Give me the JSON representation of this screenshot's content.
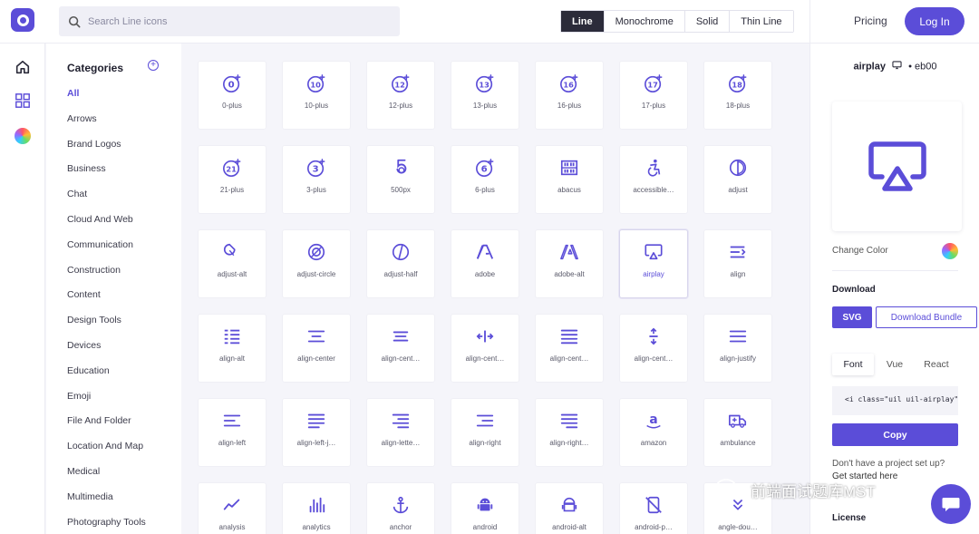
{
  "search": {
    "placeholder": "Search Line icons"
  },
  "styles": [
    "Line",
    "Monochrome",
    "Solid",
    "Thin Line"
  ],
  "active_style": "Line",
  "header": {
    "pricing": "Pricing",
    "login": "Log In"
  },
  "categories": {
    "title": "Categories",
    "items": [
      "All",
      "Arrows",
      "Brand Logos",
      "Business",
      "Chat",
      "Cloud And Web",
      "Communication",
      "Construction",
      "Content",
      "Design Tools",
      "Devices",
      "Education",
      "Emoji",
      "File And Folder",
      "Location And Map",
      "Medical",
      "Multimedia",
      "Photography Tools"
    ],
    "active": "All"
  },
  "icons": [
    {
      "label": "0-plus",
      "icon": "0-plus-icon"
    },
    {
      "label": "10-plus",
      "icon": "10-plus-icon"
    },
    {
      "label": "12-plus",
      "icon": "12-plus-icon"
    },
    {
      "label": "13-plus",
      "icon": "13-plus-icon"
    },
    {
      "label": "16-plus",
      "icon": "16-plus-icon"
    },
    {
      "label": "17-plus",
      "icon": "17-plus-icon"
    },
    {
      "label": "18-plus",
      "icon": "18-plus-icon"
    },
    {
      "label": "21-plus",
      "icon": "21-plus-icon"
    },
    {
      "label": "3-plus",
      "icon": "3-plus-icon"
    },
    {
      "label": "500px",
      "icon": "500px-icon"
    },
    {
      "label": "6-plus",
      "icon": "6-plus-icon"
    },
    {
      "label": "abacus",
      "icon": "abacus-icon"
    },
    {
      "label": "accessible…",
      "icon": "accessible-icon"
    },
    {
      "label": "adjust",
      "icon": "adjust-icon"
    },
    {
      "label": "adjust-alt",
      "icon": "adjust-alt-icon"
    },
    {
      "label": "adjust-circle",
      "icon": "adjust-circle-icon"
    },
    {
      "label": "adjust-half",
      "icon": "adjust-half-icon"
    },
    {
      "label": "adobe",
      "icon": "adobe-icon"
    },
    {
      "label": "adobe-alt",
      "icon": "adobe-alt-icon"
    },
    {
      "label": "airplay",
      "icon": "airplay-icon",
      "selected": true
    },
    {
      "label": "align",
      "icon": "align-icon"
    },
    {
      "label": "align-alt",
      "icon": "align-alt-icon"
    },
    {
      "label": "align-center",
      "icon": "align-center-icon"
    },
    {
      "label": "align-cent…",
      "icon": "align-center-alt-icon"
    },
    {
      "label": "align-cent…",
      "icon": "align-center-h-icon"
    },
    {
      "label": "align-cent…",
      "icon": "align-center-justify-icon"
    },
    {
      "label": "align-cent…",
      "icon": "align-center-v-icon"
    },
    {
      "label": "align-justify",
      "icon": "align-justify-icon"
    },
    {
      "label": "align-left",
      "icon": "align-left-icon"
    },
    {
      "label": "align-left-j…",
      "icon": "align-left-justify-icon"
    },
    {
      "label": "align-lette…",
      "icon": "align-letter-rtl-icon"
    },
    {
      "label": "align-right",
      "icon": "align-right-icon"
    },
    {
      "label": "align-right…",
      "icon": "align-right-justify-icon"
    },
    {
      "label": "amazon",
      "icon": "amazon-icon"
    },
    {
      "label": "ambulance",
      "icon": "ambulance-icon"
    },
    {
      "label": "analysis",
      "icon": "analysis-icon"
    },
    {
      "label": "analytics",
      "icon": "analytics-icon"
    },
    {
      "label": "anchor",
      "icon": "anchor-icon"
    },
    {
      "label": "android",
      "icon": "android-icon"
    },
    {
      "label": "android-alt",
      "icon": "android-alt-icon"
    },
    {
      "label": "android-p…",
      "icon": "android-phone-slash-icon"
    },
    {
      "label": "angle-dou…",
      "icon": "angle-double-icon"
    }
  ],
  "panel": {
    "icon_name": "airplay",
    "code_id": "eb00",
    "change_color": "Change Color",
    "download": "Download",
    "svg": "SVG",
    "bundle": "Download Bundle",
    "tabs": [
      "Font",
      "Vue",
      "React"
    ],
    "active_tab": "Font",
    "code": "<i class=\"uil uil-airplay\">",
    "copy": "Copy",
    "no_project": "Don't have a project set up?",
    "get_started": "Get started here",
    "license": "License"
  },
  "watermark": "前端面试题库MST",
  "colors": {
    "accent": "#5b4dd8",
    "dark": "#2b2b3a",
    "bg": "#f5f5fa"
  }
}
